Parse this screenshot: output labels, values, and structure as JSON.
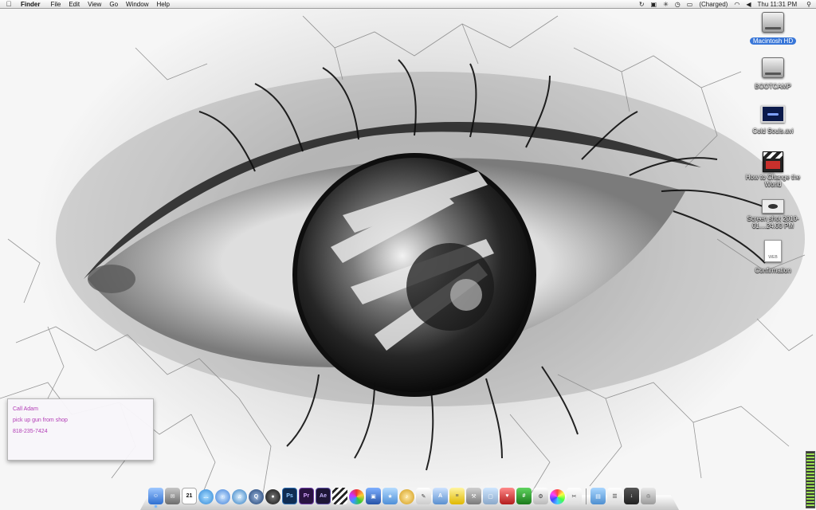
{
  "menubar": {
    "apple_icon": "apple-logo",
    "app_name": "Finder",
    "menus": [
      "File",
      "Edit",
      "View",
      "Go",
      "Window",
      "Help"
    ],
    "status": {
      "battery": "(Charged)",
      "clock": "Thu 11:31 PM"
    }
  },
  "desktop_icons": [
    {
      "label": "Macintosh HD",
      "kind": "hard-drive",
      "selected": true
    },
    {
      "label": "BOOTCAMP",
      "kind": "hard-drive",
      "selected": false
    },
    {
      "label": "Cold Souls.avi",
      "kind": "movie",
      "selected": false
    },
    {
      "label": "How to Change the World",
      "kind": "clapper",
      "selected": false
    },
    {
      "label": "Screen shot 2010-01....24.00 PM",
      "kind": "screenshot",
      "selected": false
    },
    {
      "label": "Confirmation",
      "kind": "web-document",
      "selected": false
    }
  ],
  "sticky_note": {
    "lines": [
      "Call Adam",
      "pick up gun from shop",
      "818-235-7424"
    ],
    "text_color": "#b23bb5"
  },
  "dock": {
    "calendar_day": "21",
    "ps_label": "Ps",
    "pr_label": "Pr",
    "ae_label": "Ae"
  },
  "colors": {
    "selection": "#3876d8",
    "dock_indicator": "#78b7ff"
  }
}
